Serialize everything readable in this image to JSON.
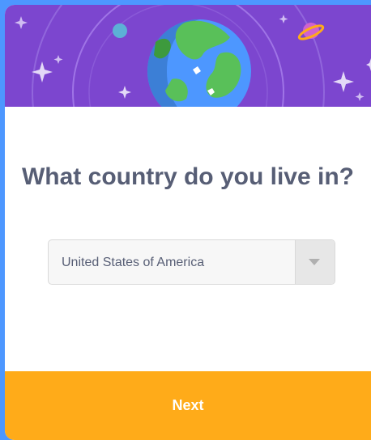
{
  "question": {
    "title": "What country do you live in?"
  },
  "country_select": {
    "selected": "United States of America"
  },
  "footer": {
    "next_label": "Next"
  },
  "colors": {
    "header_bg": "#7c46cf",
    "footer_bg": "#ffab19",
    "page_bg": "#4d97ff",
    "text": "#575e75"
  },
  "icons": [
    "globe-icon",
    "planet-icon",
    "moon-icon",
    "sparkle-icon",
    "chevron-down-icon"
  ]
}
